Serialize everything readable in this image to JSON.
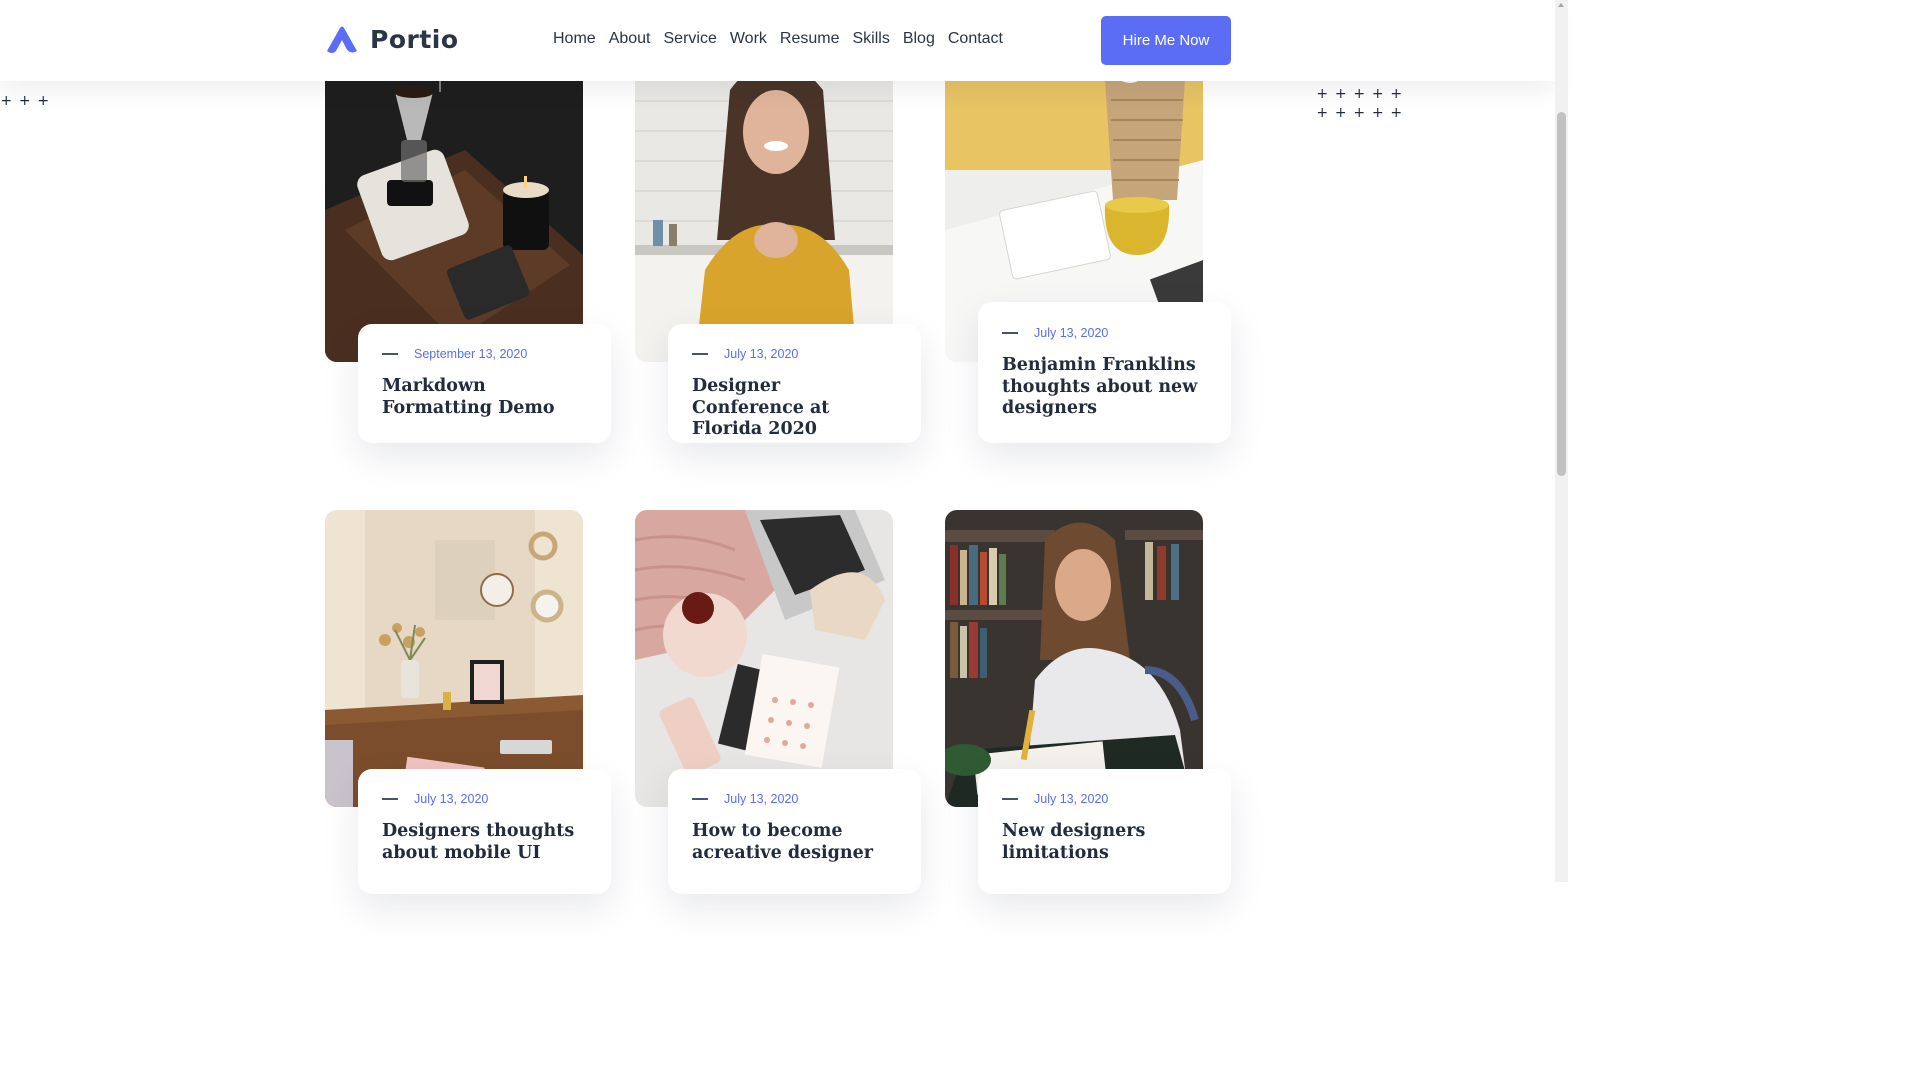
{
  "brand": {
    "name": "Portio",
    "accent": "#5b6cf5",
    "logo_icon": "portio-a-mark"
  },
  "nav": {
    "items": [
      {
        "label": "Home"
      },
      {
        "label": "About"
      },
      {
        "label": "Service"
      },
      {
        "label": "Work"
      },
      {
        "label": "Resume"
      },
      {
        "label": "Skills"
      },
      {
        "label": "Blog"
      },
      {
        "label": "Contact"
      }
    ],
    "cta_label": "Hire Me Now"
  },
  "posts": [
    {
      "date": "September 13, 2020",
      "title": "Markdown Formatting Demo",
      "image": "coffee-pour-over-scene"
    },
    {
      "date": "July 13, 2020",
      "title": "Designer Conference at Florida 2020",
      "image": "smiling-woman-yellow-sweater"
    },
    {
      "date": "July 13, 2020",
      "title": "Benjamin Franklins thoughts about new designers",
      "image": "desk-notebook-yellow-mug"
    },
    {
      "date": "July 13, 2020",
      "title": "Designers thoughts about mobile UI",
      "image": "desk-with-plants-and-mirrors"
    },
    {
      "date": "July 13, 2020",
      "title": "How to become acreative designer",
      "image": "laptop-notebook-flatlay"
    },
    {
      "date": "July 13, 2020",
      "title": "New designers limitations",
      "image": "woman-writing-library"
    }
  ]
}
